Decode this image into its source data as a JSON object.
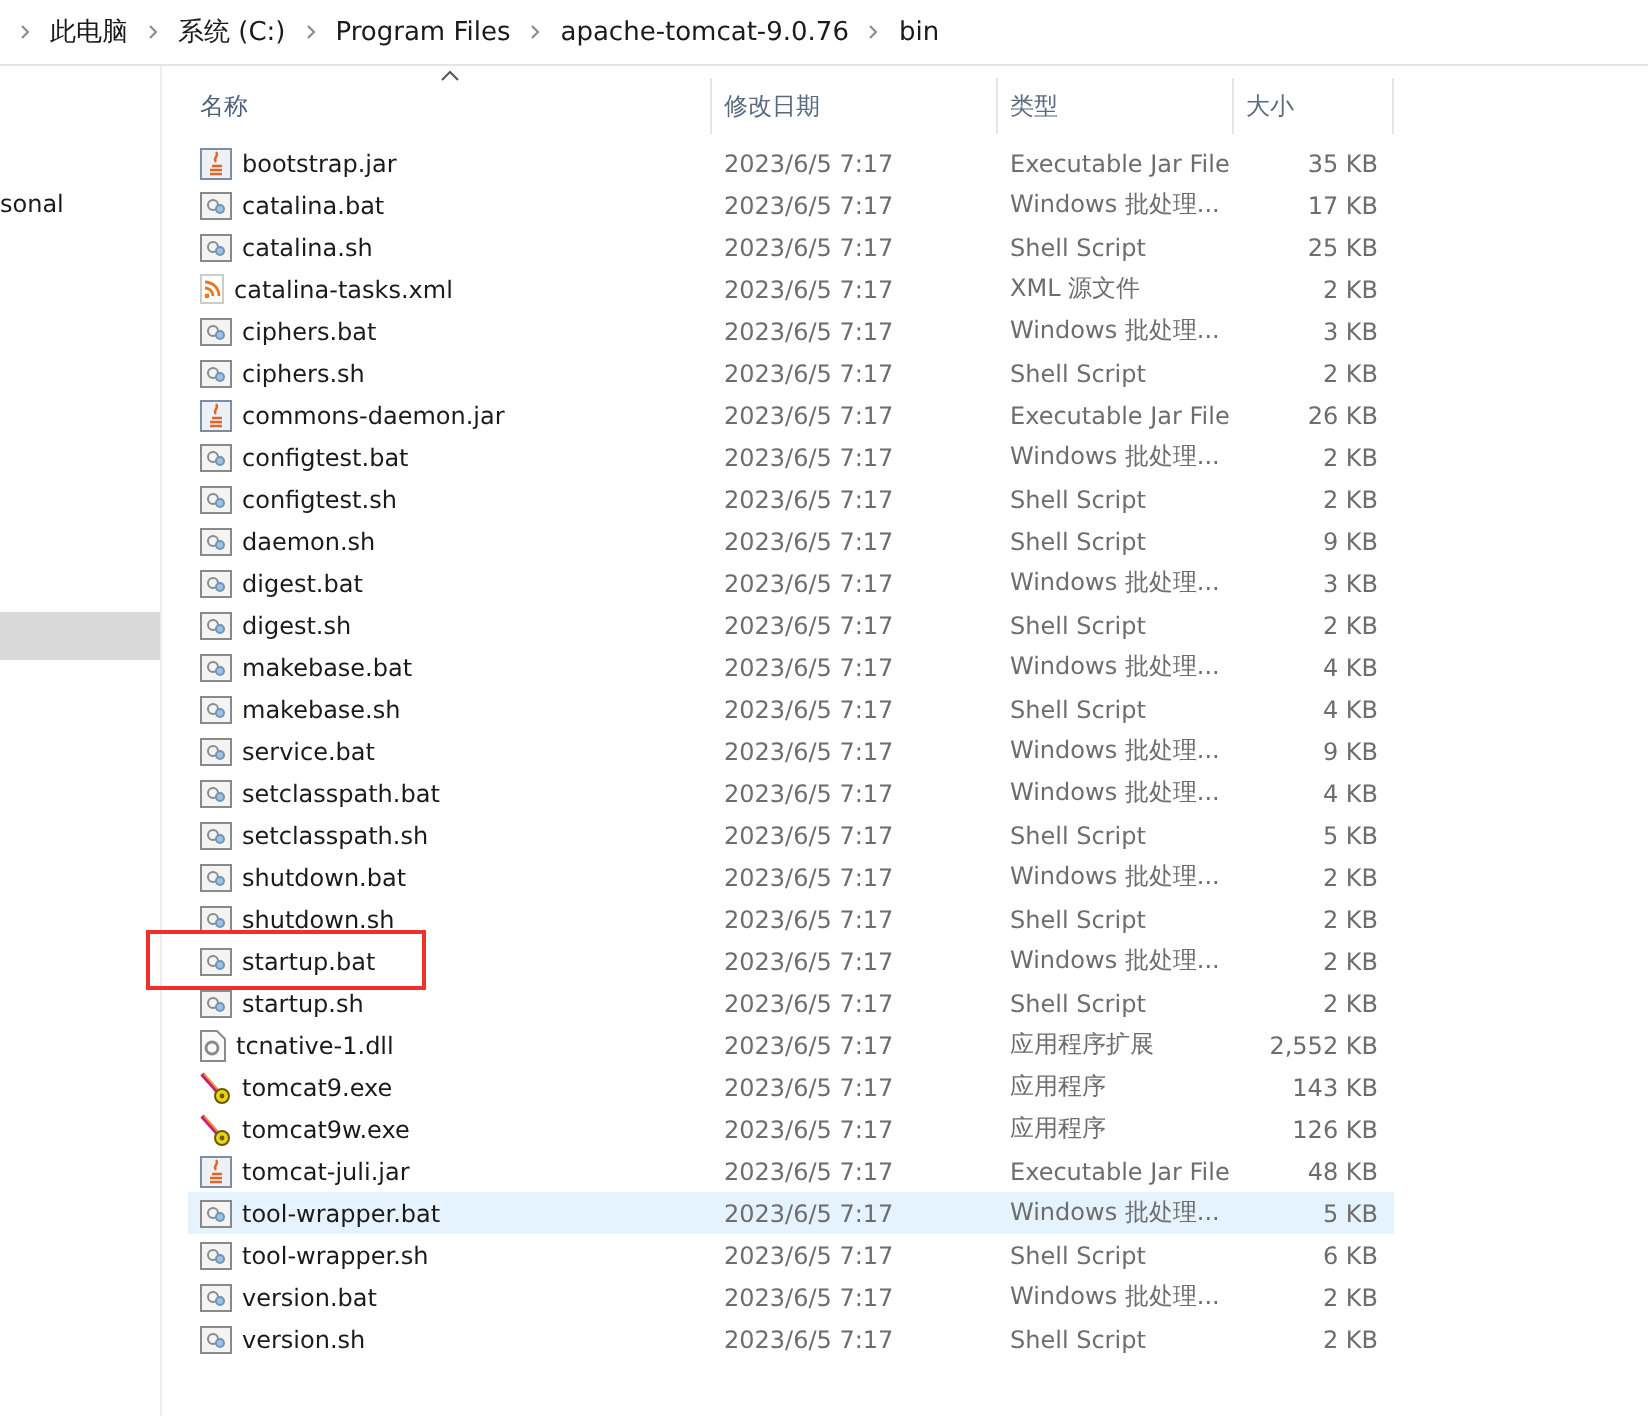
{
  "breadcrumb": [
    "此电脑",
    "系统 (C:)",
    "Program Files",
    "apache-tomcat-9.0.76",
    "bin"
  ],
  "nav": {
    "items": [
      {
        "label": "sonal",
        "selected": false
      },
      {
        "selected": true
      }
    ]
  },
  "columns": [
    {
      "label": "名称",
      "sorted": true
    },
    {
      "label": "修改日期",
      "sorted": false
    },
    {
      "label": "类型",
      "sorted": false
    },
    {
      "label": "大小",
      "sorted": false
    }
  ],
  "rows": [
    {
      "kind": "jar",
      "name": "bootstrap.jar",
      "date": "2023/6/5 7:17",
      "type": "Executable Jar File",
      "size": "35 KB",
      "selected": false,
      "highlighted": false
    },
    {
      "kind": "script",
      "name": "catalina.bat",
      "date": "2023/6/5 7:17",
      "type": "Windows 批处理...",
      "size": "17 KB",
      "selected": false,
      "highlighted": false
    },
    {
      "kind": "script",
      "name": "catalina.sh",
      "date": "2023/6/5 7:17",
      "type": "Shell Script",
      "size": "25 KB",
      "selected": false,
      "highlighted": false
    },
    {
      "kind": "xml",
      "name": "catalina-tasks.xml",
      "date": "2023/6/5 7:17",
      "type": "XML 源文件",
      "size": "2 KB",
      "selected": false,
      "highlighted": false
    },
    {
      "kind": "script",
      "name": "ciphers.bat",
      "date": "2023/6/5 7:17",
      "type": "Windows 批处理...",
      "size": "3 KB",
      "selected": false,
      "highlighted": false
    },
    {
      "kind": "script",
      "name": "ciphers.sh",
      "date": "2023/6/5 7:17",
      "type": "Shell Script",
      "size": "2 KB",
      "selected": false,
      "highlighted": false
    },
    {
      "kind": "jar",
      "name": "commons-daemon.jar",
      "date": "2023/6/5 7:17",
      "type": "Executable Jar File",
      "size": "26 KB",
      "selected": false,
      "highlighted": false
    },
    {
      "kind": "script",
      "name": "configtest.bat",
      "date": "2023/6/5 7:17",
      "type": "Windows 批处理...",
      "size": "2 KB",
      "selected": false,
      "highlighted": false
    },
    {
      "kind": "script",
      "name": "configtest.sh",
      "date": "2023/6/5 7:17",
      "type": "Shell Script",
      "size": "2 KB",
      "selected": false,
      "highlighted": false
    },
    {
      "kind": "script",
      "name": "daemon.sh",
      "date": "2023/6/5 7:17",
      "type": "Shell Script",
      "size": "9 KB",
      "selected": false,
      "highlighted": false
    },
    {
      "kind": "script",
      "name": "digest.bat",
      "date": "2023/6/5 7:17",
      "type": "Windows 批处理...",
      "size": "3 KB",
      "selected": false,
      "highlighted": false
    },
    {
      "kind": "script",
      "name": "digest.sh",
      "date": "2023/6/5 7:17",
      "type": "Shell Script",
      "size": "2 KB",
      "selected": false,
      "highlighted": false
    },
    {
      "kind": "script",
      "name": "makebase.bat",
      "date": "2023/6/5 7:17",
      "type": "Windows 批处理...",
      "size": "4 KB",
      "selected": false,
      "highlighted": false
    },
    {
      "kind": "script",
      "name": "makebase.sh",
      "date": "2023/6/5 7:17",
      "type": "Shell Script",
      "size": "4 KB",
      "selected": false,
      "highlighted": false
    },
    {
      "kind": "script",
      "name": "service.bat",
      "date": "2023/6/5 7:17",
      "type": "Windows 批处理...",
      "size": "9 KB",
      "selected": false,
      "highlighted": false
    },
    {
      "kind": "script",
      "name": "setclasspath.bat",
      "date": "2023/6/5 7:17",
      "type": "Windows 批处理...",
      "size": "4 KB",
      "selected": false,
      "highlighted": false
    },
    {
      "kind": "script",
      "name": "setclasspath.sh",
      "date": "2023/6/5 7:17",
      "type": "Shell Script",
      "size": "5 KB",
      "selected": false,
      "highlighted": false
    },
    {
      "kind": "script",
      "name": "shutdown.bat",
      "date": "2023/6/5 7:17",
      "type": "Windows 批处理...",
      "size": "2 KB",
      "selected": false,
      "highlighted": false
    },
    {
      "kind": "script",
      "name": "shutdown.sh",
      "date": "2023/6/5 7:17",
      "type": "Shell Script",
      "size": "2 KB",
      "selected": false,
      "highlighted": false
    },
    {
      "kind": "script",
      "name": "startup.bat",
      "date": "2023/6/5 7:17",
      "type": "Windows 批处理...",
      "size": "2 KB",
      "selected": false,
      "highlighted": true
    },
    {
      "kind": "script",
      "name": "startup.sh",
      "date": "2023/6/5 7:17",
      "type": "Shell Script",
      "size": "2 KB",
      "selected": false,
      "highlighted": false
    },
    {
      "kind": "dll",
      "name": "tcnative-1.dll",
      "date": "2023/6/5 7:17",
      "type": "应用程序扩展",
      "size": "2,552 KB",
      "selected": false,
      "highlighted": false
    },
    {
      "kind": "exe",
      "name": "tomcat9.exe",
      "date": "2023/6/5 7:17",
      "type": "应用程序",
      "size": "143 KB",
      "selected": false,
      "highlighted": false
    },
    {
      "kind": "exe",
      "name": "tomcat9w.exe",
      "date": "2023/6/5 7:17",
      "type": "应用程序",
      "size": "126 KB",
      "selected": false,
      "highlighted": false
    },
    {
      "kind": "jar",
      "name": "tomcat-juli.jar",
      "date": "2023/6/5 7:17",
      "type": "Executable Jar File",
      "size": "48 KB",
      "selected": false,
      "highlighted": false
    },
    {
      "kind": "script",
      "name": "tool-wrapper.bat",
      "date": "2023/6/5 7:17",
      "type": "Windows 批处理...",
      "size": "5 KB",
      "selected": true,
      "highlighted": false
    },
    {
      "kind": "script",
      "name": "tool-wrapper.sh",
      "date": "2023/6/5 7:17",
      "type": "Shell Script",
      "size": "6 KB",
      "selected": false,
      "highlighted": false
    },
    {
      "kind": "script",
      "name": "version.bat",
      "date": "2023/6/5 7:17",
      "type": "Windows 批处理...",
      "size": "2 KB",
      "selected": false,
      "highlighted": false
    },
    {
      "kind": "script",
      "name": "version.sh",
      "date": "2023/6/5 7:17",
      "type": "Shell Script",
      "size": "2 KB",
      "selected": false,
      "highlighted": false
    }
  ]
}
